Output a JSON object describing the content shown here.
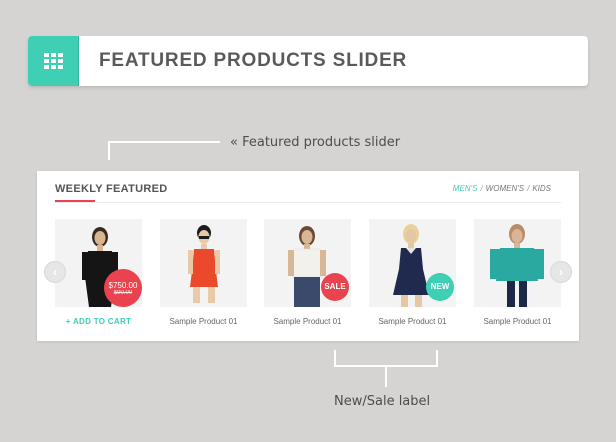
{
  "banner": {
    "title": "FEATURED PRODUCTS SLIDER",
    "icon": "grid-icon",
    "accent_color": "#3fcfb4"
  },
  "callouts": {
    "top_label": "«  Featured products slider",
    "bottom_label": "New/Sale label"
  },
  "panel": {
    "title": "WEEKLY FEATURED",
    "categories": [
      "MEN'S",
      "WOMEN'S",
      "KIDS"
    ],
    "active_category": "MEN'S",
    "separator": "/",
    "prev_icon": "chevron-left-icon",
    "next_icon": "chevron-right-icon",
    "prev_symbol": "‹",
    "next_symbol": "›"
  },
  "products": [
    {
      "name": "+ ADD TO CART",
      "action": true,
      "badge": {
        "type": "price",
        "price": "$750.00",
        "old_price": "$90.00"
      },
      "palette": [
        "#151515",
        "#3a2a22",
        "#d9b58f"
      ]
    },
    {
      "name": "Sample Product 01",
      "action": false,
      "badge": null,
      "palette": [
        "#ea4a2b",
        "#1d1d1d",
        "#e8c9a8"
      ]
    },
    {
      "name": "Sample Product 01",
      "action": false,
      "badge": {
        "type": "sale",
        "text": "SALE"
      },
      "palette": [
        "#f3f1ec",
        "#3b4a6b",
        "#d8b796"
      ]
    },
    {
      "name": "Sample Product 01",
      "action": false,
      "badge": {
        "type": "new",
        "text": "NEW"
      },
      "palette": [
        "#1f2a4e",
        "#e4e4e4",
        "#e6c7a4"
      ]
    },
    {
      "name": "Sample Product 01",
      "action": false,
      "badge": null,
      "palette": [
        "#29a9a0",
        "#1d2846",
        "#b98a6b"
      ]
    }
  ]
}
